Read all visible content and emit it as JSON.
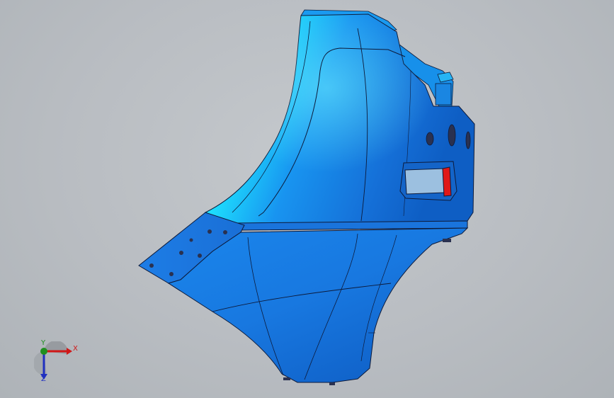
{
  "viewport": {
    "background": "#bfc3c7"
  },
  "model": {
    "body_color": "#1a7fe6",
    "highlight_color": "#1ee6ff",
    "shade_color": "#0a56b8",
    "edge_color": "#0d1a3a",
    "accent_color": "#e01818",
    "hole_color": "#2a3150"
  },
  "triad": {
    "x_label": "X",
    "y_label": "Y",
    "z_label": "Z",
    "x_color": "#d01818",
    "y_color": "#1f8f1f",
    "z_color": "#2030c0"
  }
}
